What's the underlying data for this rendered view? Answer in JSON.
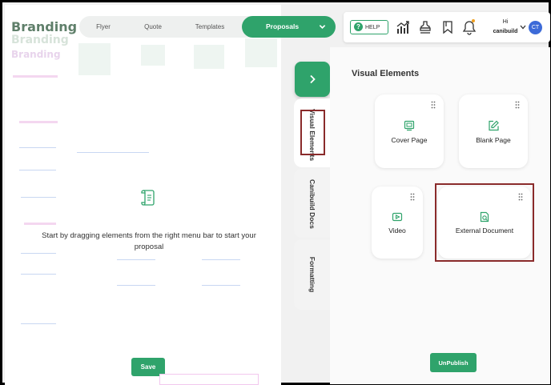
{
  "brand": {
    "title": "Branding"
  },
  "tabs": {
    "items": [
      {
        "label": "Flyer"
      },
      {
        "label": "Quote"
      },
      {
        "label": "Templates"
      }
    ],
    "active": {
      "label": "Proposals"
    }
  },
  "header": {
    "help_label": "HELP",
    "greeting": "Hi",
    "user_name": "canibuild",
    "avatar_initials": "CT"
  },
  "canvas": {
    "empty_message": "Start by dragging elements from the right menu bar to start your proposal",
    "save_label": "Save"
  },
  "rail": {
    "tabs": [
      {
        "label": "Visual Elements"
      },
      {
        "label": "Canibuild Docs"
      },
      {
        "label": "Formatting"
      }
    ]
  },
  "panel": {
    "title": "Visual Elements",
    "cards": [
      {
        "label": "Cover Page",
        "icon": "cover-page-icon"
      },
      {
        "label": "Blank Page",
        "icon": "edit-page-icon"
      },
      {
        "label": "Video",
        "icon": "video-icon"
      },
      {
        "label": "External Document",
        "icon": "document-search-icon"
      }
    ],
    "unpublish_label": "UnPublish"
  },
  "colors": {
    "accent": "#2fa36b",
    "avatar": "#3d6bd8",
    "highlight_border": "#8a2b2b",
    "bell_dot": "#f0a020"
  }
}
